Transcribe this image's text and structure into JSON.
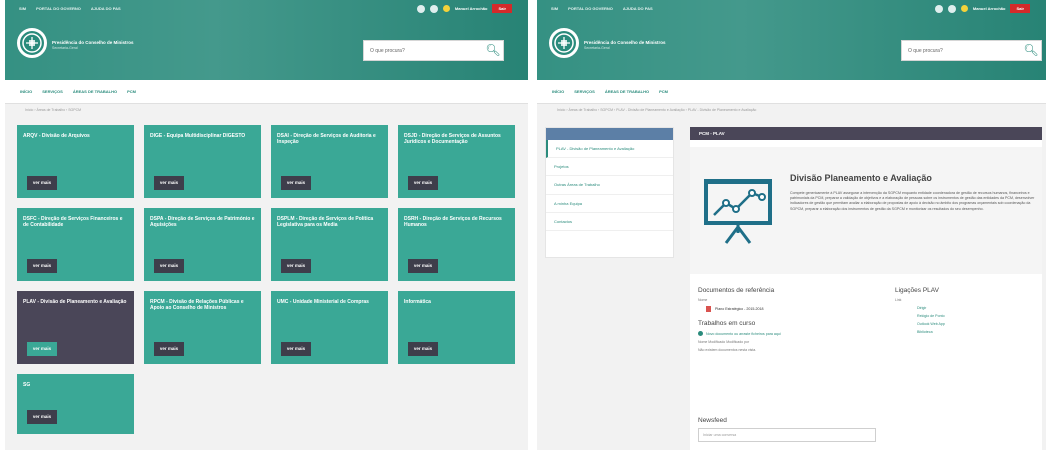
{
  "common": {
    "top_links": [
      "SIM",
      "Portal do Governo",
      "Ajuda do PAS"
    ],
    "user_name": "Manuel Arrochão",
    "exit_label": "Sair",
    "site_title": "Presidência do Conselho de Ministros",
    "site_subtitle": "Secretaria-Geral",
    "search_placeholder": "O que procura?",
    "colors": {
      "brand": "#2a8b7c",
      "card": "#3aa896",
      "card_active": "#4a4658",
      "exit": "#d42a2a"
    }
  },
  "left": {
    "nav": [
      "Início",
      "Serviços",
      "Áreas de Trabalho",
      "PCM"
    ],
    "breadcrumb": "Início › Áreas de Trabalho › SGPCM",
    "cards": [
      {
        "title": "ARQV - Divisão de Arquivos",
        "button": "ver mais"
      },
      {
        "title": "DIGE - Equipa Multidisciplinar DIGESTO",
        "button": "ver mais"
      },
      {
        "title": "DSAI - Direção de Serviços de Auditoria e Inspeção",
        "button": "ver mais"
      },
      {
        "title": "DSJD - Direção de Serviços de Assuntos Jurídicos e Documentação",
        "button": "ver mais"
      },
      {
        "title": "DSFC - Direção de Serviços Financeiros e de Contabilidade",
        "button": "ver mais"
      },
      {
        "title": "DSPA - Direção de Serviços de Património e Aquisições",
        "button": "ver mais"
      },
      {
        "title": "DSPLM - Direção de Serviços de Política Legislativa para os Media",
        "button": "ver mais"
      },
      {
        "title": "DSRH - Direção de Serviços de Recursos Humanos",
        "button": "ver mais"
      },
      {
        "title": "PLAV - Divisão de Planeamento e Avaliação",
        "button": "ver mais",
        "active": true
      },
      {
        "title": "RPCM - Divisão de Relações Públicas e Apoio ao Conselho de Ministros",
        "button": "ver mais"
      },
      {
        "title": "UMC - Unidade Ministerial de Compras",
        "button": "ver mais"
      },
      {
        "title": "Informática",
        "button": "ver mais"
      },
      {
        "title": "SG",
        "button": "ver mais"
      }
    ]
  },
  "right": {
    "nav": [
      "Início",
      "Serviços",
      "Áreas de Trabalho",
      "PCM"
    ],
    "breadcrumb": "Início › Áreas de Trabalho › SGPCM › PLAV - Divisão de Planeamento e Avaliação › PLAV - Divisão de Planeamento e Avaliação",
    "page_header": "PCM - PLAV",
    "sidebar_items": [
      "PLAV - Divisão de Planeamento e Avaliação",
      "Projetos",
      "Outras Áreas de Trabalho",
      "A minha Equipa",
      "Contactos"
    ],
    "feature_title": "Divisão Planeamento e Avaliação",
    "feature_desc": "Compete genericamente à PLAV assegurar a intervenção da SGPCM enquanto entidade coordenadora de gestão de recursos humanos, financeiros e patrimoniais da PCM, preparar a validação de objetivos e a elaboração de pessoas sobre os instrumentos de gestão das entidades da PCM, desenvolver indicadores de gestão que permitam avaliar a elaboração de propostas de apoio à decisão no âmbito dos programas orçamentais sob coordenação da SGPCM, preparar a elaboração dos instrumentos de gestão da SGPCM e monitorizar os resultados do seu desempenho.",
    "docs_title": "Documentos de referência",
    "docs_header": "Nome",
    "doc_name": "Plano Estratégico - 2015-2018",
    "links_title": "Ligações PLAV",
    "links_header": "Link",
    "links": [
      "Dirigir",
      "Relógio de Ponto",
      "Outlook Web App",
      "Biblioteca"
    ],
    "work_title": "Trabalhos em curso",
    "work_new": "Novo documento ou arraste ficheiros para aqui",
    "work_cols": "Nome   Modificado   Modificado por",
    "work_empty": "Não existem documentos nesta vista.",
    "newsfeed_title": "Newsfeed",
    "newsfeed_placeholder": "Iniciar uma conversa"
  }
}
